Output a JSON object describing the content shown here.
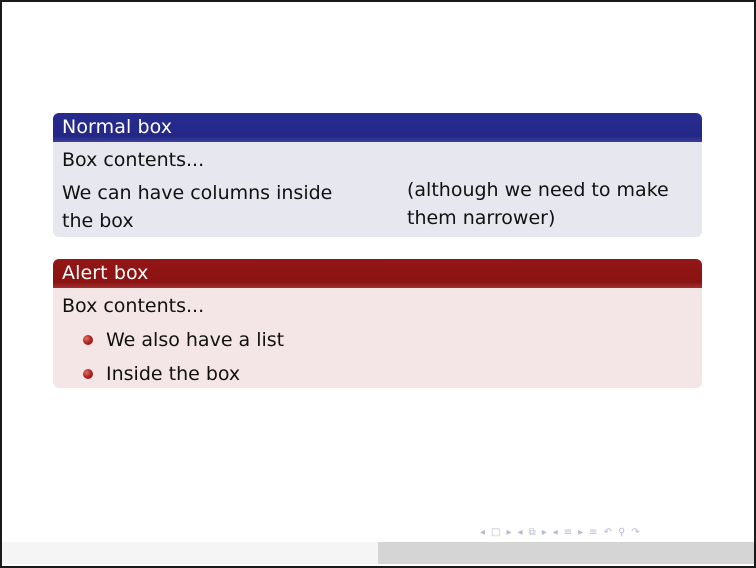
{
  "normal_block": {
    "title": "Normal box",
    "line1": "Box contents...",
    "col_left": "We can have columns inside the box",
    "col_right": "(although we need to make them narrower)"
  },
  "alert_block": {
    "title": "Alert box",
    "line1": "Box contents...",
    "items": [
      "We also have a list",
      "Inside the box"
    ]
  },
  "navigation": {
    "icons": [
      "frame-prev-icon",
      "frame-icon",
      "frame-next-icon",
      "subsection-prev-icon",
      "subsection-icon",
      "subsection-next-icon",
      "section-prev-icon",
      "section-icon",
      "section-next-icon",
      "align-icon",
      "back-icon",
      "search-icon",
      "forward-icon"
    ],
    "color": "#b7b9d6"
  },
  "colors": {
    "normal_title_bg": "#232888",
    "normal_body_bg": "#e6e7ef",
    "alert_title_bg": "#8c1313",
    "alert_body_bg": "#f4e6e6"
  }
}
